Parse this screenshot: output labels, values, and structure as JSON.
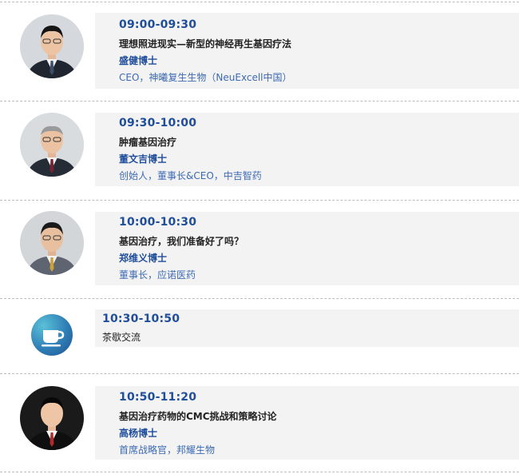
{
  "colors": {
    "accent_blue": "#1f4e9a",
    "role_blue": "#3d6ab3",
    "card_bg": "#f3f3f3",
    "divider": "#bdbdbd",
    "tea_gradient": [
      "#5bc0d7",
      "#2f7fb7",
      "#1f4f8f"
    ]
  },
  "sessions": [
    {
      "time": "09:00-09:30",
      "title": "理想照进现实—新型的神经再生基因疗法",
      "speaker": "盛健博士",
      "role": "CEO，神曦复生生物（NeuExcell中国）",
      "avatar_icon": "speaker-portrait"
    },
    {
      "time": "09:30-10:00",
      "title": "肿瘤基因治疗",
      "speaker": "董文吉博士",
      "role": "创始人，董事长&CEO，中吉智药",
      "avatar_icon": "speaker-portrait"
    },
    {
      "time": "10:00-10:30",
      "title": "基因治疗，我们准备好了吗？",
      "speaker": "郑维义博士",
      "role": "董事长，应诺医药",
      "avatar_icon": "speaker-portrait"
    },
    {
      "time": "10:30-10:50",
      "title": "茶歇交流",
      "icon": "coffee-cup-icon"
    },
    {
      "time": "10:50-11:20",
      "title": "基因治疗药物的CMC挑战和策略讨论",
      "speaker": "高杨博士",
      "role": "首席战略官，邦耀生物",
      "avatar_icon": "speaker-portrait"
    }
  ]
}
